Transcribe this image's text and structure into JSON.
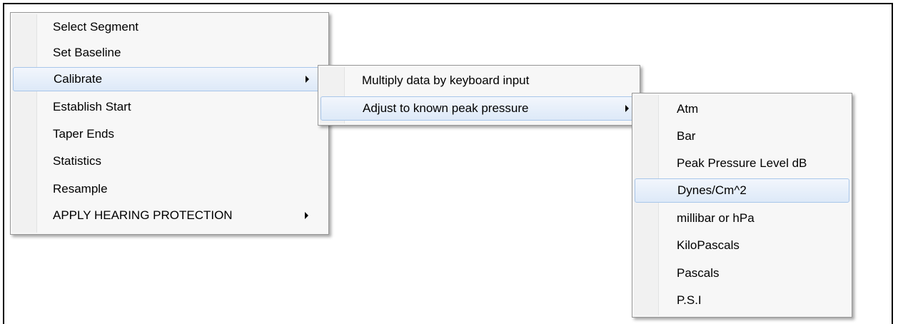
{
  "main_menu": {
    "items": [
      {
        "label": "Select Segment"
      },
      {
        "label": "Set Baseline"
      },
      {
        "label": "Calibrate"
      },
      {
        "label": "Establish Start"
      },
      {
        "label": "Taper Ends"
      },
      {
        "label": "Statistics"
      },
      {
        "label": "Resample"
      },
      {
        "label": "APPLY HEARING PROTECTION"
      }
    ]
  },
  "calibrate_submenu": {
    "items": [
      {
        "label": "Multiply data by keyboard input"
      },
      {
        "label": "Adjust to known peak pressure"
      }
    ]
  },
  "units_submenu": {
    "items": [
      {
        "label": "Atm"
      },
      {
        "label": "Bar"
      },
      {
        "label": "Peak Pressure Level dB"
      },
      {
        "label": "Dynes/Cm^2"
      },
      {
        "label": "millibar or hPa"
      },
      {
        "label": "KiloPascals"
      },
      {
        "label": "Pascals"
      },
      {
        "label": "P.S.I"
      }
    ]
  },
  "icons": {
    "submenu_arrow": "submenu-arrow-icon"
  },
  "colors": {
    "highlight_border": "#a8c6ea",
    "highlight_fill": "#dde9f8",
    "menu_background": "#f7f7f7"
  }
}
